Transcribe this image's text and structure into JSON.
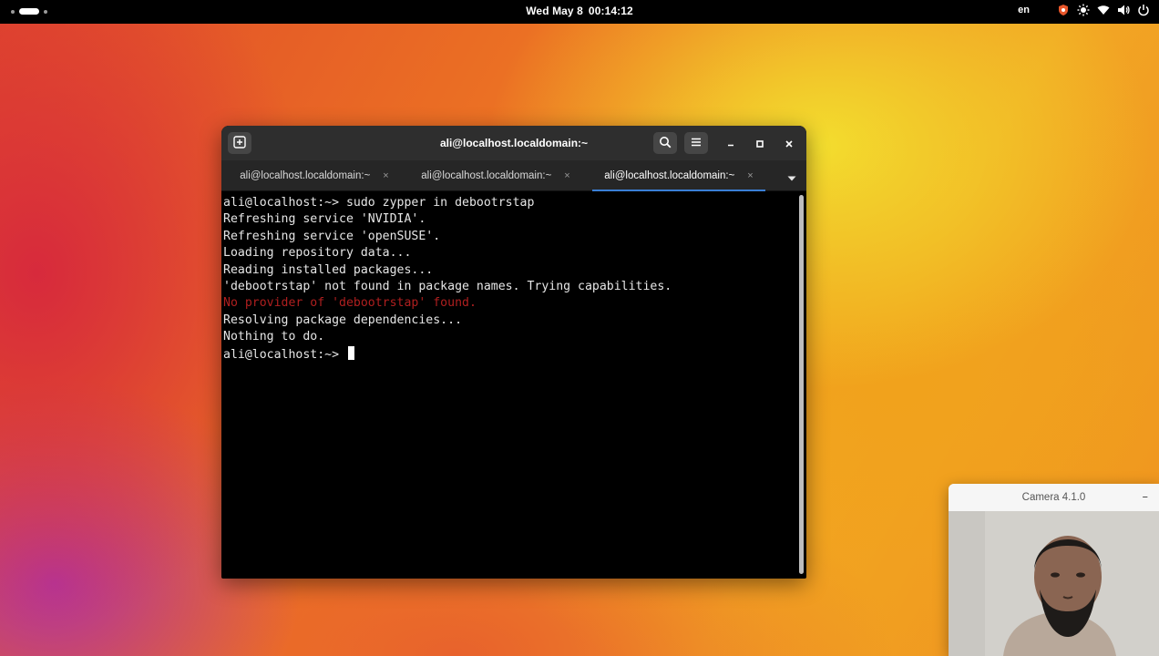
{
  "topbar": {
    "date": "Wed May 8",
    "time": "00:14:12",
    "language": "en",
    "tray_icons": [
      "shield-icon",
      "brightness-icon",
      "wifi-icon",
      "volume-icon",
      "power-icon"
    ]
  },
  "terminal": {
    "title": "ali@localhost.localdomain:~",
    "tabs": [
      {
        "label": "ali@localhost.localdomain:~",
        "close": "×",
        "active": false
      },
      {
        "label": "ali@localhost.localdomain:~",
        "close": "×",
        "active": false
      },
      {
        "label": "ali@localhost.localdomain:~",
        "close": "×",
        "active": true
      }
    ],
    "lines": [
      {
        "text": "ali@localhost:~> sudo zypper in debootrstap",
        "type": "normal"
      },
      {
        "text": "Refreshing service 'NVIDIA'.",
        "type": "normal"
      },
      {
        "text": "Refreshing service 'openSUSE'.",
        "type": "normal"
      },
      {
        "text": "Loading repository data...",
        "type": "normal"
      },
      {
        "text": "Reading installed packages...",
        "type": "normal"
      },
      {
        "text": "'debootrstap' not found in package names. Trying capabilities.",
        "type": "normal"
      },
      {
        "text": "No provider of 'debootrstap' found.",
        "type": "error"
      },
      {
        "text": "Resolving package dependencies...",
        "type": "normal"
      },
      {
        "text": "Nothing to do.",
        "type": "normal"
      }
    ],
    "prompt": "ali@localhost:~> ",
    "colors": {
      "error": "#b01f1f",
      "active_tab_indicator": "#3a7fd6"
    }
  },
  "camera": {
    "title": "Camera 4.1.0",
    "minimize": "–"
  }
}
